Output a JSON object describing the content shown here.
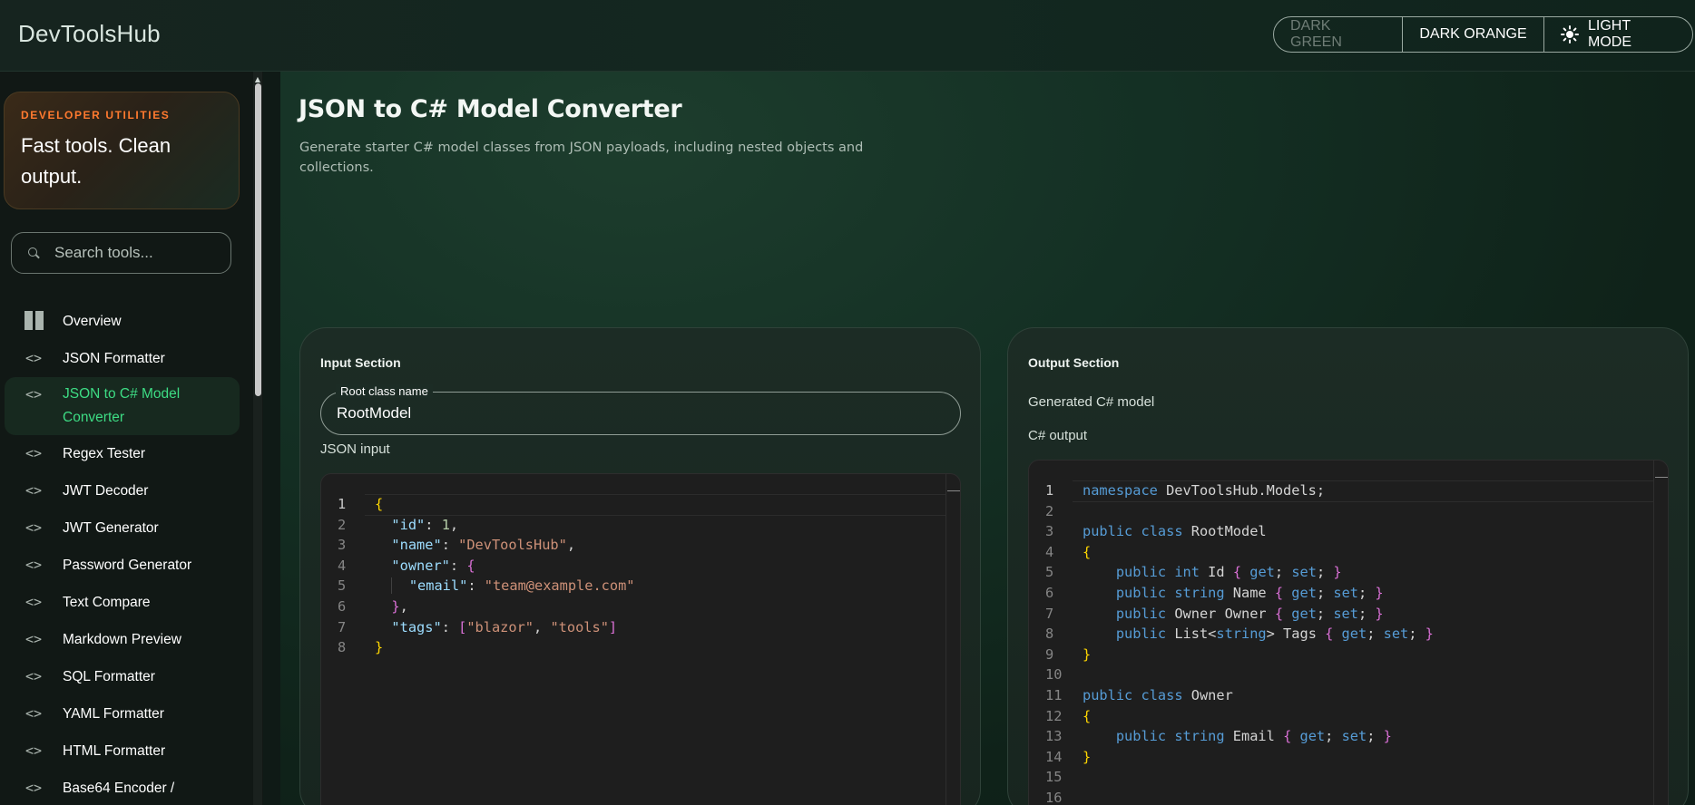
{
  "app": {
    "title": "DevToolsHub"
  },
  "theme_switcher": {
    "options": [
      {
        "label": "DARK GREEN",
        "disabled": true
      },
      {
        "label": "DARK ORANGE",
        "disabled": false
      },
      {
        "label": "LIGHT MODE",
        "disabled": false,
        "icon": "sun-icon"
      }
    ]
  },
  "sidebar": {
    "promo": {
      "kicker": "DEVELOPER UTILITIES",
      "text": "Fast tools. Clean output."
    },
    "search": {
      "placeholder": "Search tools..."
    },
    "items": [
      {
        "label": "Overview",
        "icon": "dashboard-icon"
      },
      {
        "label": "JSON Formatter",
        "icon": "code-icon"
      },
      {
        "label": "JSON to C# Model Converter",
        "icon": "code-icon",
        "active": true
      },
      {
        "label": "Regex Tester",
        "icon": "code-icon"
      },
      {
        "label": "JWT Decoder",
        "icon": "code-icon"
      },
      {
        "label": "JWT Generator",
        "icon": "code-icon"
      },
      {
        "label": "Password Generator",
        "icon": "code-icon"
      },
      {
        "label": "Text Compare",
        "icon": "code-icon"
      },
      {
        "label": "Markdown Preview",
        "icon": "code-icon"
      },
      {
        "label": "SQL Formatter",
        "icon": "code-icon"
      },
      {
        "label": "YAML Formatter",
        "icon": "code-icon"
      },
      {
        "label": "HTML Formatter",
        "icon": "code-icon"
      },
      {
        "label": "Base64 Encoder /",
        "icon": "code-icon"
      }
    ]
  },
  "page": {
    "title": "JSON to C# Model Converter",
    "description": "Generate starter C# model classes from JSON payloads, including nested objects and collections."
  },
  "input_section": {
    "title": "Input Section",
    "root_class_label": "Root class name",
    "root_class_value": "RootModel",
    "json_label": "JSON input",
    "json_lines": [
      "{",
      "  \"id\": 1,",
      "  \"name\": \"DevToolsHub\",",
      "  \"owner\": {",
      "    \"email\": \"team@example.com\"",
      "  },",
      "  \"tags\": [\"blazor\", \"tools\"]",
      "}"
    ]
  },
  "output_section": {
    "title": "Output Section",
    "generated_label": "Generated C# model",
    "output_label": "C# output",
    "cs_lines": [
      "namespace DevToolsHub.Models;",
      "",
      "public class RootModel",
      "{",
      "    public int Id { get; set; }",
      "    public string Name { get; set; }",
      "    public Owner Owner { get; set; }",
      "    public List<string> Tags { get; set; }",
      "}",
      "",
      "public class Owner",
      "{",
      "    public string Email { get; set; }",
      "}",
      "",
      ""
    ]
  },
  "colors": {
    "accent_green": "#3ddc84",
    "accent_orange": "#ff7a2f",
    "editor_bg": "#1e1e1e"
  }
}
